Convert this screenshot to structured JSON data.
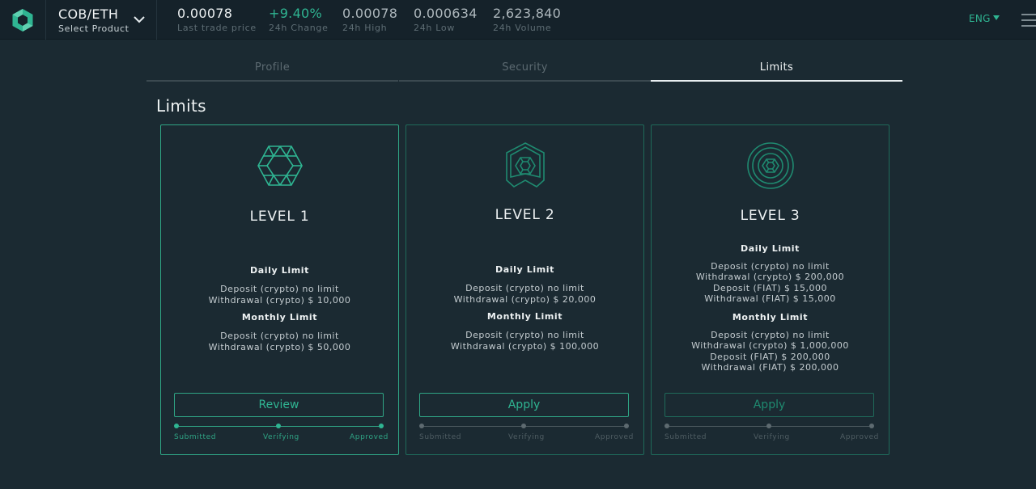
{
  "header": {
    "product": {
      "name": "COB/ETH",
      "sub": "Select Product"
    },
    "stats": [
      {
        "value": "0.00078",
        "label": "Last trade price"
      },
      {
        "value": "+9.40%",
        "label": "24h Change"
      },
      {
        "value": "0.00078",
        "label": "24h High"
      },
      {
        "value": "0.000634",
        "label": "24h Low"
      },
      {
        "value": "2,623,840",
        "label": "24h Volume"
      }
    ],
    "language": "ENG"
  },
  "tabs": [
    {
      "label": "Profile",
      "active": false
    },
    {
      "label": "Security",
      "active": false
    },
    {
      "label": "Limits",
      "active": true
    }
  ],
  "page_title": "Limits",
  "colors": {
    "accent": "#2fb592",
    "background": "#1b2a32",
    "topbar": "#15222a"
  },
  "cards": [
    {
      "level": "LEVEL 1",
      "icon": "hexagon-lattice-icon",
      "daily_title": "Daily Limit",
      "daily": [
        "Deposit (crypto) no limit",
        "Withdrawal (crypto) $ 10,000"
      ],
      "monthly_title": "Monthly Limit",
      "monthly": [
        "Deposit (crypto) no limit",
        "Withdrawal (crypto) $ 50,000"
      ],
      "button": "Review",
      "steps": [
        "Submitted",
        "Verifying",
        "Approved"
      ]
    },
    {
      "level": "LEVEL 2",
      "icon": "ribbon-badge-icon",
      "daily_title": "Daily Limit",
      "daily": [
        "Deposit (crypto) no limit",
        "Withdrawal (crypto) $ 20,000"
      ],
      "monthly_title": "Monthly Limit",
      "monthly": [
        "Deposit (crypto) no limit",
        "Withdrawal (crypto) $ 100,000"
      ],
      "button": "Apply",
      "steps": [
        "Submitted",
        "Verifying",
        "Approved"
      ]
    },
    {
      "level": "LEVEL 3",
      "icon": "circle-seal-icon",
      "daily_title": "Daily Limit",
      "daily": [
        "Deposit (crypto) no limit",
        "Withdrawal (crypto) $ 200,000",
        "Deposit (FIAT) $ 15,000",
        "Withdrawal (FIAT) $ 15,000"
      ],
      "monthly_title": "Monthly Limit",
      "monthly": [
        "Deposit (crypto) no limit",
        "Withdrawal (crypto) $ 1,000,000",
        "Deposit (FIAT) $ 200,000",
        "Withdrawal (FIAT) $ 200,000"
      ],
      "button": "Apply",
      "steps": [
        "Submitted",
        "Verifying",
        "Approved"
      ]
    }
  ]
}
